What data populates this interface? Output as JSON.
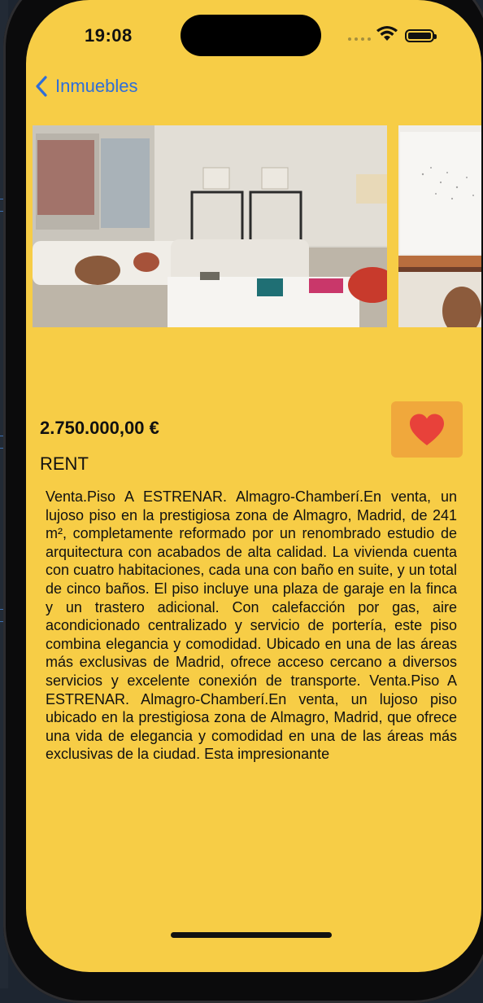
{
  "status_bar": {
    "time": "19:08"
  },
  "nav": {
    "back_label": "Inmuebles"
  },
  "listing": {
    "price": "2.750.000,00 €",
    "operation": "RENT",
    "favorite_color": "#e8413a",
    "description": "Venta.Piso A ESTRENAR. Almagro-Chamberí.En venta, un lujoso piso en la prestigiosa zona de Almagro, Madrid, de 241 m², completamente reformado por un renombrado estudio de arquitectura con acabados de alta calidad. La vivienda cuenta con cuatro habitaciones, cada una con baño en suite, y un total de cinco baños. El piso incluye una plaza de garaje en la finca y un trastero adicional. Con calefacción por gas, aire acondicionado centralizado y servicio de portería, este piso combina elegancia y comodidad. Ubicado en una de las áreas más exclusivas de Madrid, ofrece acceso cercano a diversos servicios y excelente conexión de transporte.    Venta.Piso A ESTRENAR. Almagro-Chamberí.En venta, un lujoso piso ubicado en la prestigiosa zona de Almagro, Madrid, que ofrece una vida de elegancia y comodidad en una de las áreas más exclusivas de la ciudad. Esta impresionante"
  },
  "theme": {
    "background": "#f7cd46",
    "accent": "#2f6ed8",
    "favorite_button": "#f0a83c"
  },
  "icons": {
    "back": "chevron-left-icon",
    "favorite": "heart-icon",
    "wifi": "wifi-icon",
    "battery": "battery-icon"
  }
}
